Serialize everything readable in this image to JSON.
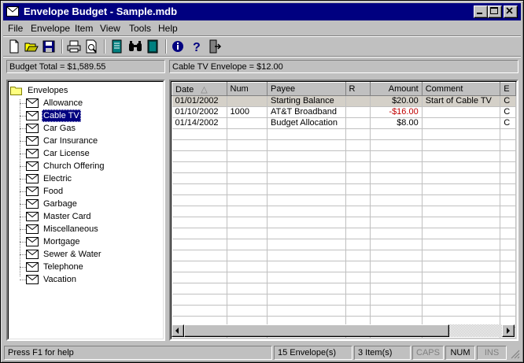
{
  "window": {
    "title": "Envelope Budget - Sample.mdb"
  },
  "menu": [
    "File",
    "Envelope",
    "Item",
    "View",
    "Tools",
    "Help"
  ],
  "toolbar_icons": [
    "new-icon",
    "open-icon",
    "save-icon",
    "print-icon",
    "print-preview-icon",
    "ledger-icon",
    "find-icon",
    "book-icon",
    "info-icon",
    "help-icon",
    "exit-icon"
  ],
  "info": {
    "budget_total": "Budget Total = $1,589.55",
    "envelope_total": "Cable TV Envelope = $12.00"
  },
  "tree": {
    "root": "Envelopes",
    "items": [
      "Allowance",
      "Cable TV",
      "Car Gas",
      "Car Insurance",
      "Car License",
      "Church Offering",
      "Electric",
      "Food",
      "Garbage",
      "Master Card",
      "Miscellaneous",
      "Mortgage",
      "Sewer & Water",
      "Telephone",
      "Vacation"
    ],
    "selected": "Cable TV"
  },
  "grid": {
    "columns": [
      "Date",
      "Num",
      "Payee",
      "R",
      "Amount",
      "Comment",
      "E"
    ],
    "rows": [
      {
        "date": "01/01/2002",
        "num": "",
        "payee": "Starting Balance",
        "r": "",
        "amount": "$20.00",
        "comment": "Start of Cable TV",
        "e": "C"
      },
      {
        "date": "01/10/2002",
        "num": "1000",
        "payee": "AT&T Broadband",
        "r": "",
        "amount": "-$16.00",
        "comment": "",
        "e": "C"
      },
      {
        "date": "01/14/2002",
        "num": "",
        "payee": "Budget Allocation",
        "r": "",
        "amount": "$8.00",
        "comment": "",
        "e": "C"
      }
    ]
  },
  "status": {
    "help": "Press F1 for help",
    "envelopes": "15 Envelope(s)",
    "items": "3 Item(s)",
    "caps": "CAPS",
    "num": "NUM",
    "ins": "INS"
  },
  "colors": {
    "title_bar": "#000080",
    "negative": "#c00000"
  }
}
